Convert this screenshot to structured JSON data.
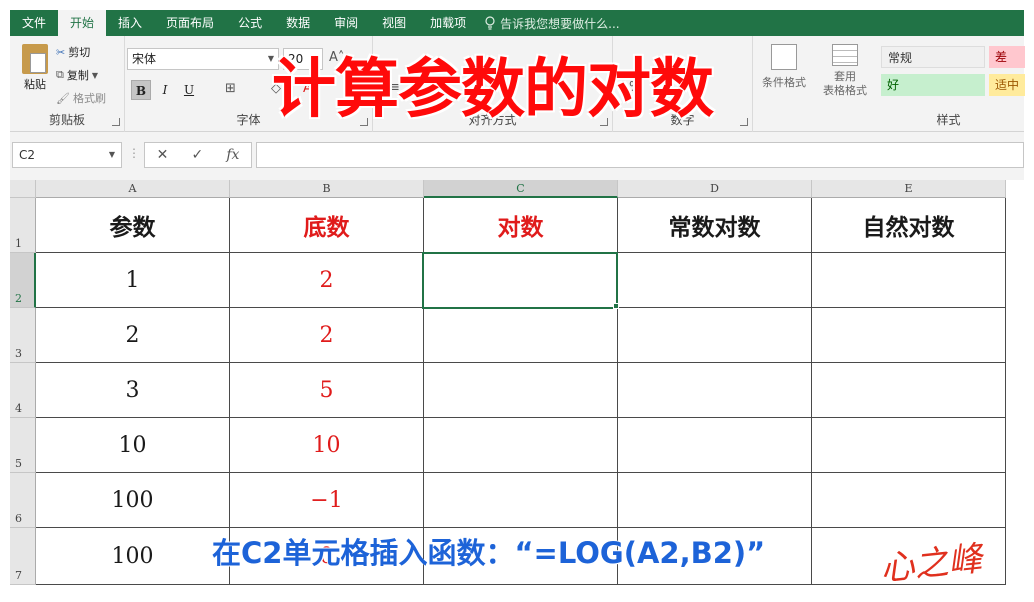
{
  "ribbon_tabs": [
    "文件",
    "开始",
    "插入",
    "页面布局",
    "公式",
    "数据",
    "审阅",
    "视图",
    "加载项"
  ],
  "tell_me": "告诉我您想要做什么...",
  "clipboard": {
    "paste": "粘贴",
    "cut": "剪切",
    "copy": "复制",
    "format_painter": "格式刷",
    "group_label": "剪贴板"
  },
  "font": {
    "name": "宋体",
    "size": "20",
    "bold": "B",
    "italic": "I",
    "underline": "U",
    "group_label": "字体"
  },
  "alignment": {
    "group_label": "对齐方式"
  },
  "number": {
    "group_label": "数字"
  },
  "styles": {
    "conditional_format": "条件格式",
    "table_format_line1": "套用",
    "table_format_line2": "表格格式",
    "normal": "常规",
    "bad": "差",
    "good": "好",
    "neutral": "适中",
    "group_label": "样式"
  },
  "name_box": "C2",
  "formula_fx": "fx",
  "columns": [
    "A",
    "B",
    "C",
    "D",
    "E"
  ],
  "rows": [
    "1",
    "2",
    "3",
    "4",
    "5",
    "6",
    "7"
  ],
  "table": {
    "headers": [
      "参数",
      "底数",
      "对数",
      "常数对数",
      "自然对数"
    ],
    "data": [
      [
        "1",
        "2",
        "",
        "",
        ""
      ],
      [
        "2",
        "2",
        "",
        "",
        ""
      ],
      [
        "3",
        "5",
        "",
        "",
        ""
      ],
      [
        "10",
        "10",
        "",
        "",
        ""
      ],
      [
        "100",
        "−1",
        "",
        "",
        ""
      ],
      [
        "100",
        "0",
        "",
        "",
        ""
      ]
    ]
  },
  "colors": {
    "accent": "#217346",
    "header_red": "#e01b1b",
    "overlay_title": "#ff0a0a",
    "overlay_caption": "#1d63d8"
  },
  "overlay_title": "计算参数的对数",
  "overlay_caption": "在C2单元格插入函数：“=LOG(A2,B2)”",
  "signature": "心之峰"
}
